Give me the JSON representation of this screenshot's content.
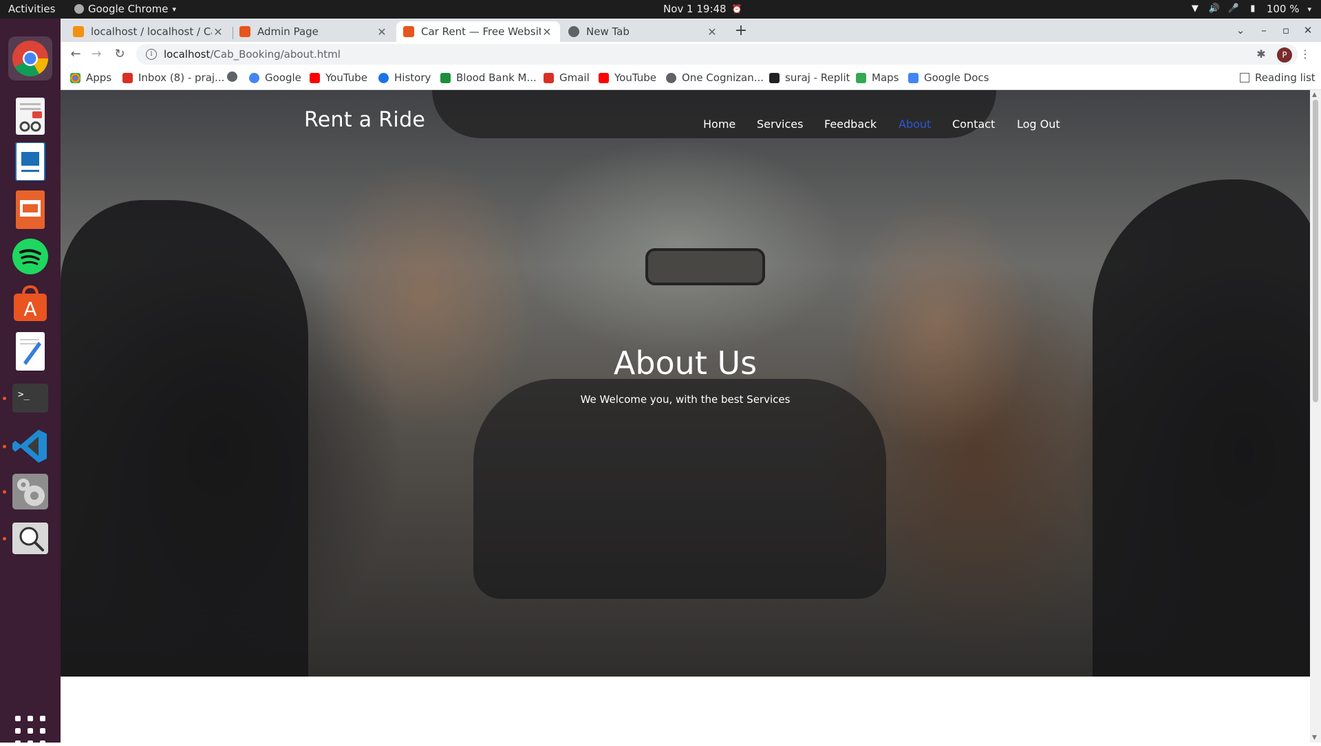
{
  "os": {
    "activities": "Activities",
    "app_menu": "Google Chrome",
    "clock": "Nov 1  19:48",
    "battery": "100 %"
  },
  "dock": {
    "items": [
      "chrome",
      "document-viewer",
      "libreoffice-impress-template",
      "libreoffice-impress",
      "spotify",
      "ubuntu-software",
      "text-editor",
      "terminal",
      "vscode",
      "settings",
      "image-viewer"
    ]
  },
  "browser": {
    "tabs": [
      {
        "title": "localhost / localhost / Cab",
        "favicon_color": "#f29111"
      },
      {
        "title": "Admin Page",
        "favicon_color": "#e8541e"
      },
      {
        "title": "Car Rent — Free Website",
        "favicon_color": "#e8541e"
      },
      {
        "title": "New Tab",
        "favicon_color": "#5f6368"
      }
    ],
    "active_tab": 2,
    "url_host": "localhost",
    "url_path": "/Cab_Booking/about.html",
    "profile_initial": "P",
    "bookmarks": [
      {
        "label": "Apps",
        "icon": "apps-grid-icon",
        "color": "#4285f4"
      },
      {
        "label": "Inbox (8) - praj...",
        "icon": "gmail-icon",
        "color": "#d93025"
      },
      {
        "label": "",
        "icon": "globe-icon",
        "color": "#5f6368"
      },
      {
        "label": "Google",
        "icon": "google-icon",
        "color": "#4285f4"
      },
      {
        "label": "YouTube",
        "icon": "youtube-icon",
        "color": "#ff0000"
      },
      {
        "label": "History",
        "icon": "history-icon",
        "color": "#1a73e8"
      },
      {
        "label": "Blood Bank M...",
        "icon": "blood-bank-icon",
        "color": "#1e8e3e"
      },
      {
        "label": "Gmail",
        "icon": "gmail-icon",
        "color": "#d93025"
      },
      {
        "label": "YouTube",
        "icon": "youtube-icon",
        "color": "#ff0000"
      },
      {
        "label": "One Cognizan...",
        "icon": "globe-icon",
        "color": "#5f6368"
      },
      {
        "label": "suraj - Replit",
        "icon": "replit-icon",
        "color": "#202124"
      },
      {
        "label": "Maps",
        "icon": "maps-icon",
        "color": "#34a853"
      },
      {
        "label": "Google Docs",
        "icon": "docs-icon",
        "color": "#4285f4"
      }
    ],
    "reading_list": "Reading list"
  },
  "page": {
    "brand": "Rent a Ride",
    "nav": [
      "Home",
      "Services",
      "Feedback",
      "About",
      "Contact",
      "Log Out"
    ],
    "current_nav": "About",
    "accent_color": "#2f56d6",
    "hero_title": "About Us",
    "hero_subtitle": "We Welcome you, with the best Services"
  }
}
